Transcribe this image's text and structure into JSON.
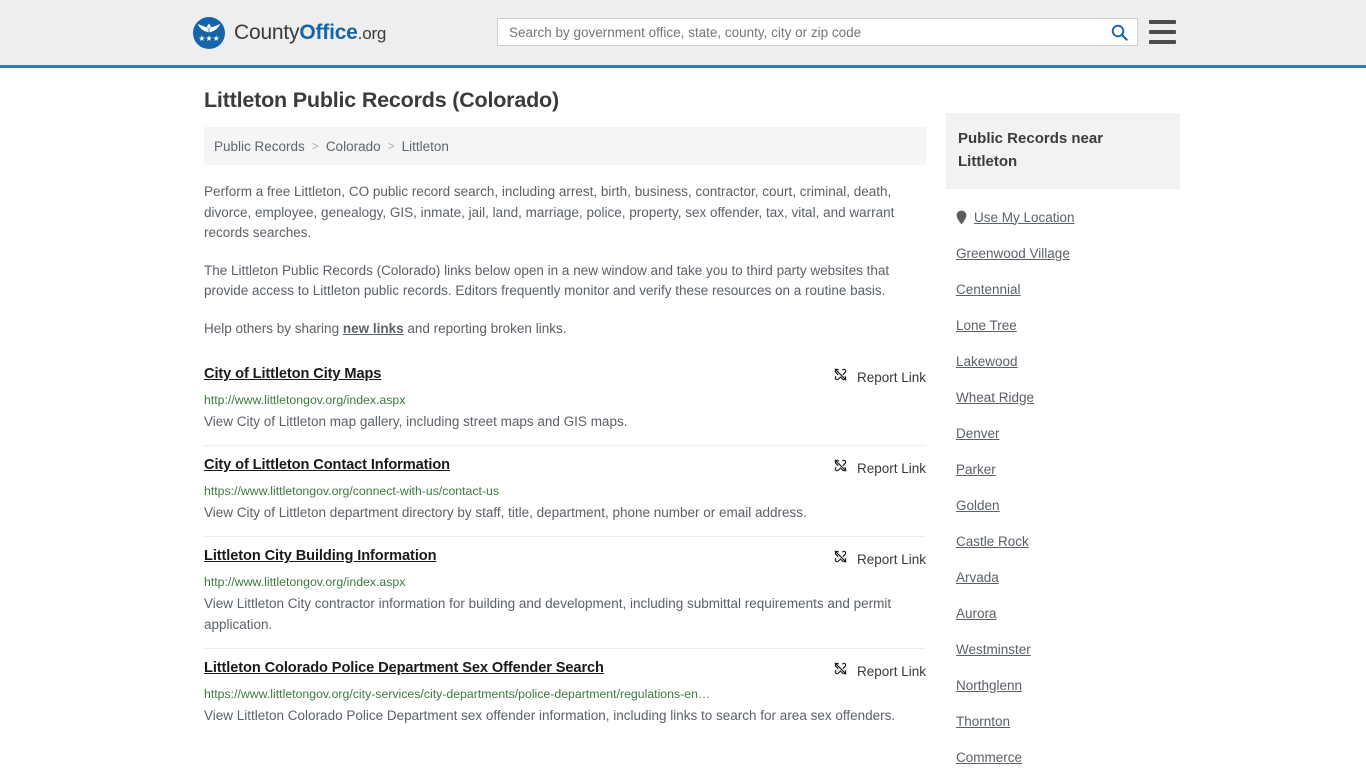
{
  "header": {
    "brand": {
      "part1": "County",
      "part2": "Office",
      "part3": ".org",
      "logo_icon": "eagle-seal-icon",
      "stars": "★★★"
    },
    "search": {
      "placeholder": "Search by government office, state, county, city or zip code",
      "value": "",
      "icon": "search-icon"
    },
    "menu": {
      "icon": "hamburger-menu-icon",
      "label": "Menu"
    },
    "accent_color": "#337ab7",
    "background_color": "#eeeeee"
  },
  "page": {
    "title": "Littleton Public Records (Colorado)"
  },
  "breadcrumb": {
    "items": [
      {
        "label": "Public Records",
        "current": false
      },
      {
        "label": "Colorado",
        "current": false
      },
      {
        "label": "Littleton",
        "current": true
      }
    ],
    "separator": ">"
  },
  "intro": {
    "p1": "Perform a free Littleton, CO public record search, including arrest, birth, business, contractor, court, criminal, death, divorce, employee, genealogy, GIS, inmate, jail, land, marriage, police, property, sex offender, tax, vital, and warrant records searches.",
    "p2": "The Littleton Public Records (Colorado) links below open in a new window and take you to third party websites that provide access to Littleton public records. Editors frequently monitor and verify these resources on a routine basis.",
    "p3_before": "Help others by sharing ",
    "p3_link": "new links",
    "p3_after": " and reporting broken links."
  },
  "results": {
    "report_label": "Report Link",
    "report_icon": "broken-link-icon",
    "items": [
      {
        "title": "City of Littleton City Maps",
        "url": "http://www.littletongov.org/index.aspx",
        "description": "View City of Littleton map gallery, including street maps and GIS maps."
      },
      {
        "title": "City of Littleton Contact Information",
        "url": "https://www.littletongov.org/connect-with-us/contact-us",
        "description": "View City of Littleton department directory by staff, title, department, phone number or email address."
      },
      {
        "title": "Littleton City Building Information",
        "url": "http://www.littletongov.org/index.aspx",
        "description": "View Littleton City contractor information for building and development, including submittal requirements and permit application."
      },
      {
        "title": "Littleton Colorado Police Department Sex Offender Search",
        "url": "https://www.littletongov.org/city-services/city-departments/police-department/regulations-en…",
        "description": "View Littleton Colorado Police Department sex offender information, including links to search for area sex offenders."
      }
    ]
  },
  "sidebar": {
    "heading": "Public Records near Littleton",
    "use_my_location": {
      "label": "Use My Location",
      "icon": "map-pin-icon"
    },
    "nearby": [
      "Greenwood Village",
      "Centennial",
      "Lone Tree",
      "Lakewood",
      "Wheat Ridge",
      "Denver",
      "Parker",
      "Golden",
      "Castle Rock",
      "Arvada",
      "Aurora",
      "Westminster",
      "Northglenn",
      "Thornton",
      "Commerce"
    ]
  }
}
